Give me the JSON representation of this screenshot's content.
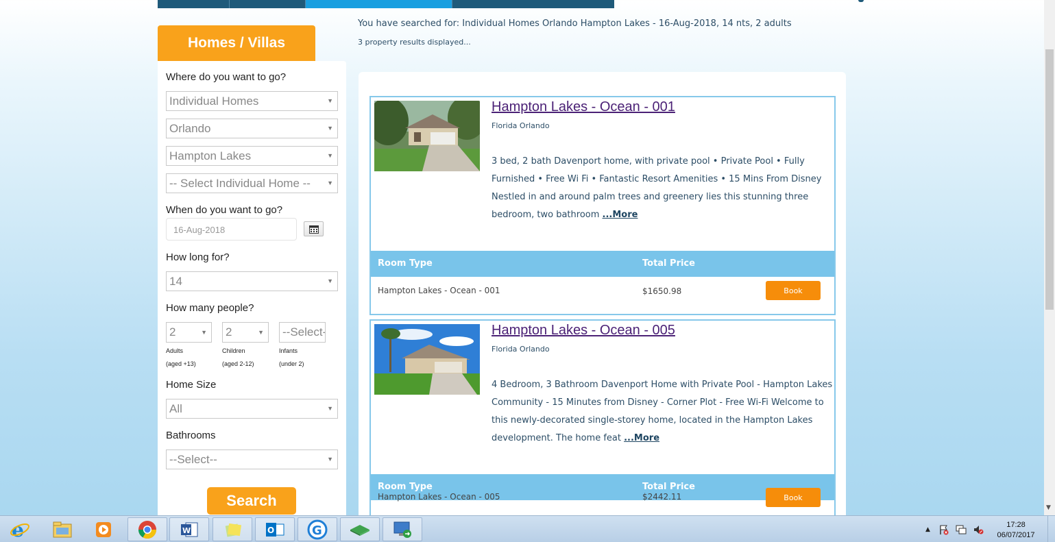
{
  "sidebar": {
    "tab_label": "Homes / Villas",
    "where_label": "Where do you want to go?",
    "selects": [
      "Individual Homes",
      "Orlando",
      "Hampton Lakes",
      "-- Select Individual Home --"
    ],
    "when_label": "When do you want to go?",
    "date_value": "16-Aug-2018",
    "how_long_label": "How long for?",
    "nights_value": "14",
    "people_label": "How many people?",
    "adults_value": "2",
    "children_value": "2",
    "infants_value": "--Select--",
    "adults_label": "Adults",
    "adults_sub": "(aged +13)",
    "children_label": "Children",
    "children_sub": "(aged 2-12)",
    "infants_label": "Infants",
    "infants_sub": "(under 2)",
    "home_size_label": "Home Size",
    "home_size_value": "All",
    "bathrooms_label": "Bathrooms",
    "bathrooms_value": "--Select--",
    "search_label": "Search"
  },
  "search_summary": "You have searched for: Individual Homes Orlando Hampton Lakes - 16-Aug-2018, 14 nts, 2 adults",
  "results_count": "3 property results displayed...",
  "properties": [
    {
      "title": "Hampton Lakes - Ocean - 001",
      "location": "Florida Orlando",
      "description": "3 bed, 2 bath Davenport home, with private pool • Private Pool • Fully Furnished • Free Wi Fi • Fantastic Resort Amenities • 15 Mins From Disney Nestled in and around palm trees and greenery lies this stunning three bedroom, two bathroom",
      "more_label": "...More",
      "room_type_header": "Room Type",
      "total_price_header": "Total Price",
      "room_type": "Hampton Lakes - Ocean - 001",
      "price": "$1650.98",
      "book_label": "Book"
    },
    {
      "title": "Hampton Lakes - Ocean - 005",
      "location": "Florida Orlando",
      "description": "4 Bedroom, 3 Bathroom Davenport Home with Private Pool - Hampton Lakes Community - 15 Minutes from Disney - Corner Plot - Free Wi-Fi Welcome to this newly-decorated single-storey home, located in the Hampton Lakes development. The home feat",
      "more_label": "...More",
      "room_type_header": "Room Type",
      "total_price_header": "Total Price",
      "room_type": "Hampton Lakes - Ocean - 005",
      "price": "$2442.11",
      "book_label": "Book"
    }
  ],
  "taskbar": {
    "apps": [
      "internet-explorer-icon",
      "file-explorer-icon",
      "media-player-icon",
      "chrome-icon",
      "word-icon",
      "sticky-notes-icon",
      "outlook-icon",
      "g-app-icon",
      "network-app-icon",
      "remote-desktop-icon"
    ],
    "time": "17:28",
    "date": "06/07/2017"
  },
  "colors": {
    "accent_orange": "#f9a21b",
    "book_orange": "#f68d0a",
    "table_header_blue": "#79c4ea",
    "card_border": "#86c8ea",
    "nav_dark": "#1f5a7a",
    "nav_active": "#1a9fe0"
  }
}
